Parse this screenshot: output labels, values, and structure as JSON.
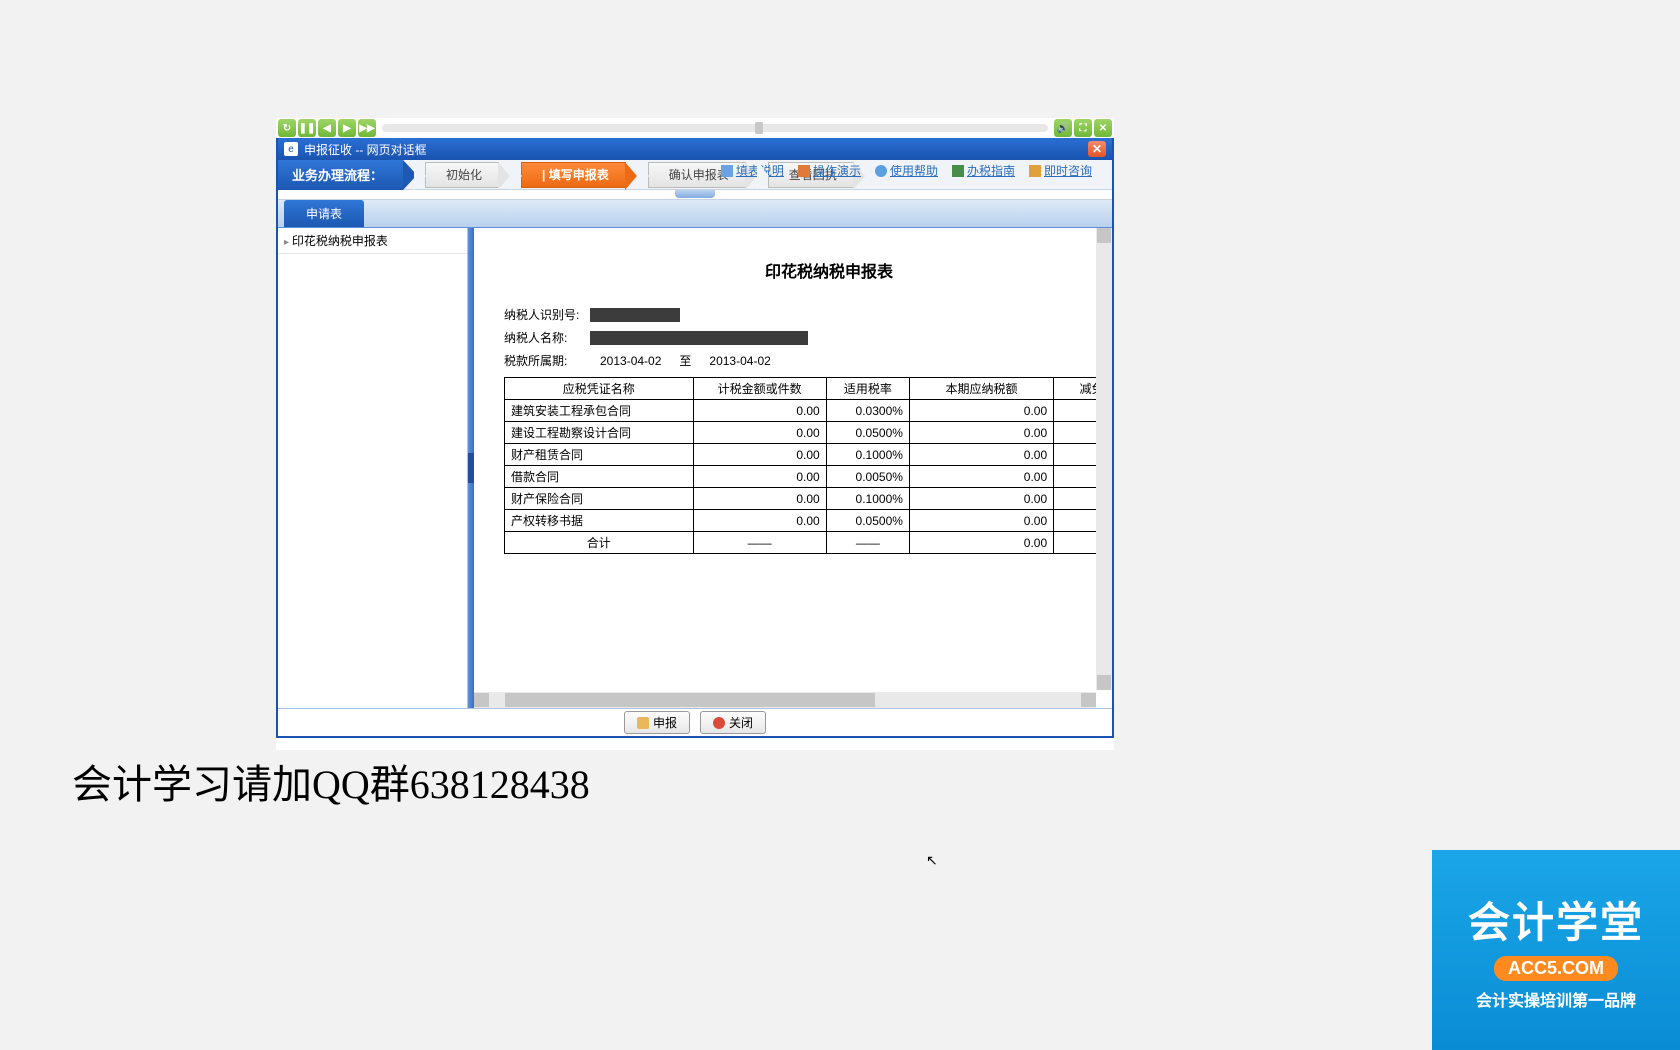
{
  "dialog": {
    "title": "申报征收 -- 网页对话框",
    "flow_label": "业务办理流程：",
    "steps": [
      "初始化",
      "| 填写申报表",
      "确认申报表",
      "查看回执"
    ],
    "top_links": [
      "填表说明",
      "操作演示",
      "使用帮助",
      "办税指南",
      "即时咨询"
    ]
  },
  "tab": {
    "label": "申请表"
  },
  "sidebar": {
    "item": "印花税纳税申报表"
  },
  "form": {
    "title": "印花税纳税申报表",
    "taxpayer_id_label": "纳税人识别号:",
    "taxpayer_name_label": "纳税人名称:",
    "period_label": "税款所属期:",
    "period_from": "2013-04-02",
    "period_sep": "至",
    "period_to": "2013-04-02",
    "columns": [
      "应税凭证名称",
      "计税金额或件数",
      "适用税率",
      "本期应纳税额",
      "减免税额"
    ],
    "rows": [
      {
        "name": "建筑安装工程承包合同",
        "amount": "0.00",
        "rate": "0.0300%",
        "tax": "0.00"
      },
      {
        "name": "建设工程勘察设计合同",
        "amount": "0.00",
        "rate": "0.0500%",
        "tax": "0.00"
      },
      {
        "name": "财产租赁合同",
        "amount": "0.00",
        "rate": "0.1000%",
        "tax": "0.00"
      },
      {
        "name": "借款合同",
        "amount": "0.00",
        "rate": "0.0050%",
        "tax": "0.00"
      },
      {
        "name": "财产保险合同",
        "amount": "0.00",
        "rate": "0.1000%",
        "tax": "0.00"
      },
      {
        "name": "产权转移书据",
        "amount": "0.00",
        "rate": "0.0500%",
        "tax": "0.00"
      }
    ],
    "total": {
      "label": "合计",
      "amount": "——",
      "rate": "——",
      "tax": "0.00"
    }
  },
  "buttons": {
    "submit": "申报",
    "close": "关闭"
  },
  "watermark": {
    "left": "会计学习请加QQ群638128438",
    "right_title": "会计学堂",
    "right_domain": "ACC5.COM",
    "right_slogan": "会计实操培训第一品牌"
  }
}
